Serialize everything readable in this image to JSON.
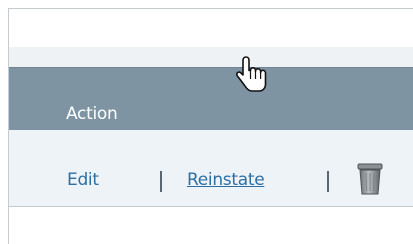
{
  "table": {
    "header": {
      "label": "Action"
    },
    "row": {
      "edit_label": "Edit",
      "separator": "|",
      "reinstate_label": "Reinstate",
      "delete_icon": "trash-can-icon"
    }
  },
  "cursor": {
    "icon": "hand-pointer-cursor-icon"
  },
  "colors": {
    "header_bg": "#7f94a2",
    "header_text": "#ffffff",
    "row_bg": "#eef3f7",
    "link": "#2e6fa3"
  }
}
